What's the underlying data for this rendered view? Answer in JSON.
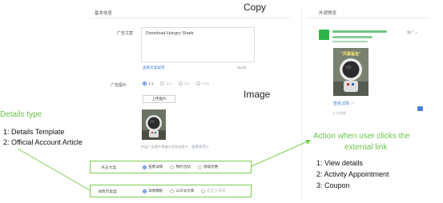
{
  "form": {
    "section_title": "基本信息",
    "copy_label": "广告文案",
    "copy_value": "Download Hungry Shark",
    "copy_link": "查看文案规范",
    "copy_counter": "11/40",
    "image_label": "广告图片",
    "image_ratio_options": [
      {
        "label": "1:1",
        "selected": true
      },
      {
        "label": "3:4",
        "selected": false
      },
      {
        "label": "4:3",
        "selected": false
      },
      {
        "label": "9:16",
        "selected": false
      }
    ],
    "upload_button": "上传图片",
    "image_hint": "外层广告图片将缩小呈现给用户，",
    "image_hint_link": "查看规范",
    "click_text_label": "点击文案",
    "click_text_options": [
      {
        "label": "查看详情",
        "selected": true
      },
      {
        "label": "预约活动",
        "selected": false
      },
      {
        "label": "领取优惠",
        "selected": false
      }
    ],
    "details_type_label": "详情页类型",
    "details_type_options": [
      {
        "label": "详情模板",
        "selected": true
      },
      {
        "label": "公众号文章",
        "selected": false
      },
      {
        "label": "自定义链接",
        "selected": false,
        "disabled": true
      }
    ]
  },
  "preview": {
    "section_title": "外观预览",
    "promo_tag": "推广",
    "image_caption": "\"风暴鲨鱼\"",
    "view_details_link": "查看详情",
    "time_text": "2 分钟前"
  },
  "annotations": {
    "copy": "Copy",
    "image": "Image",
    "details_type_title": "Details type",
    "details_type_items": [
      "1: Details Template",
      "2: Official Account Article"
    ],
    "action_title_line1": "Action when user clicks the",
    "action_title_line2": "external link",
    "action_items": [
      "1: View details",
      "2: Activity Appointment",
      "3: Coupon"
    ]
  },
  "colors": {
    "annotation_green": "#6cc24a",
    "link_blue": "#4a7fd6",
    "brand_green": "#2db34a"
  }
}
